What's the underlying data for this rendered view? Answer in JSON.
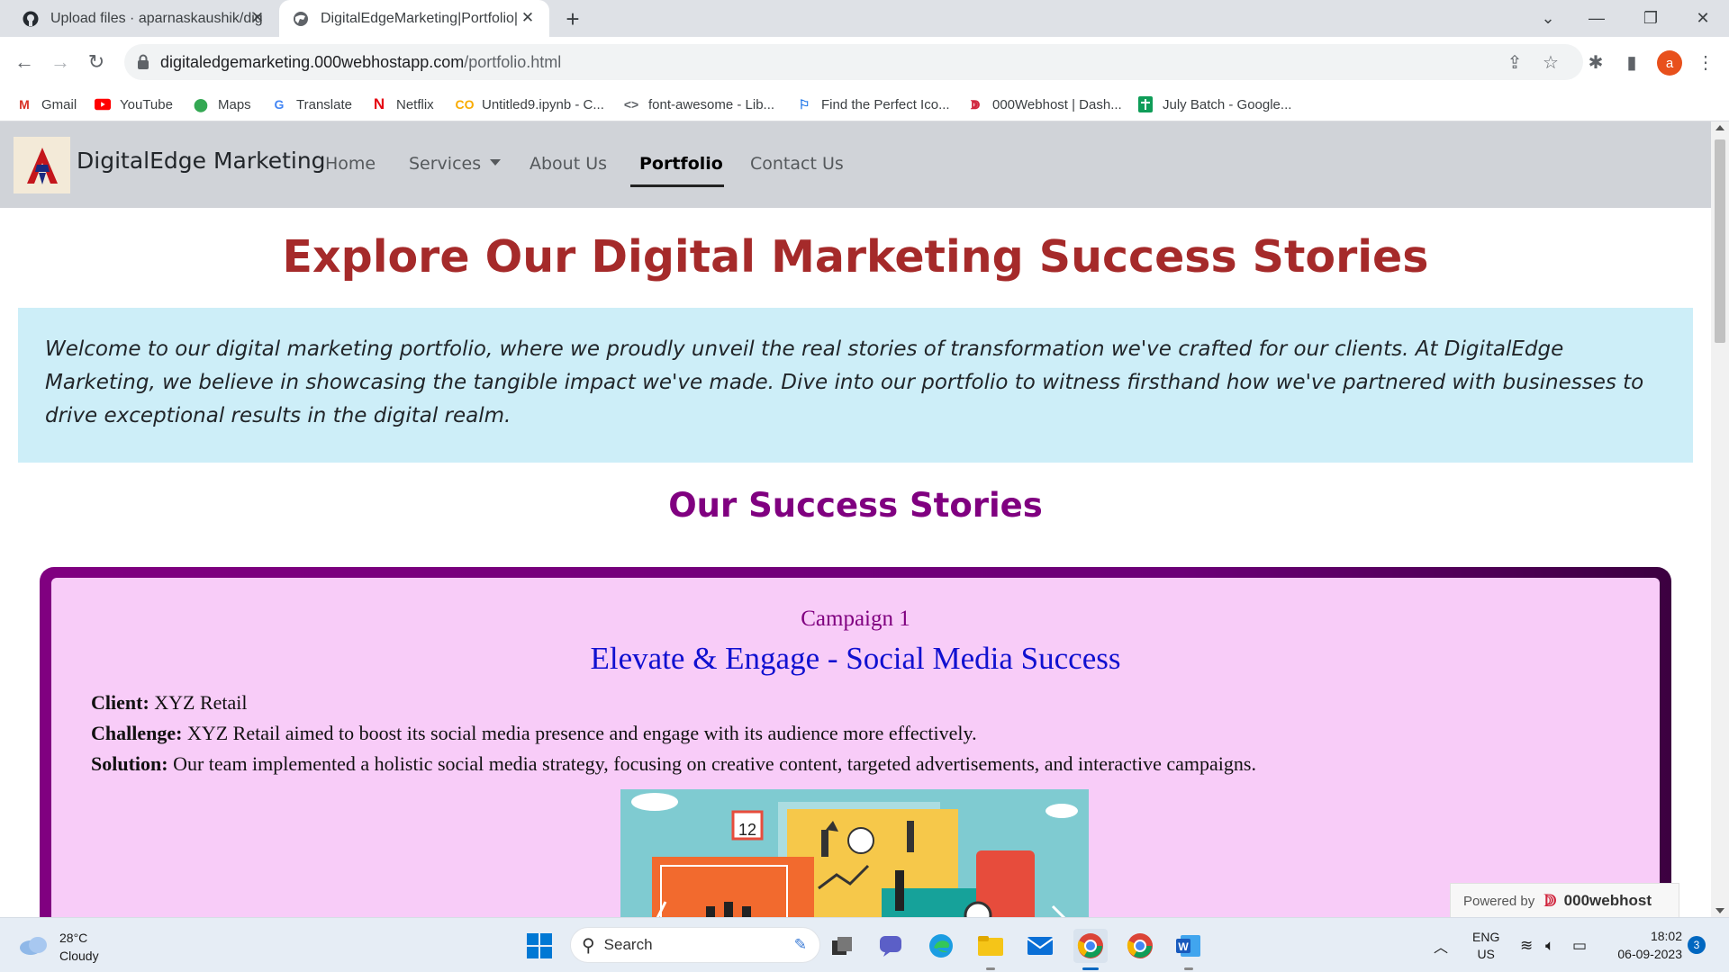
{
  "browser": {
    "tabs": [
      {
        "title": "Upload files · aparnaskaushik/dig",
        "active": false
      },
      {
        "title": "DigitalEdgeMarketing|Portfolio|",
        "active": true
      }
    ],
    "new_tab": "+",
    "url_host": "digitaledgemarketing.000webhostapp.com",
    "url_path": "/portfolio.html",
    "profile_initial": "a",
    "bookmarks": [
      {
        "label": "Gmail",
        "icon": "gmail-icon"
      },
      {
        "label": "YouTube",
        "icon": "youtube-icon"
      },
      {
        "label": "Maps",
        "icon": "maps-icon"
      },
      {
        "label": "Translate",
        "icon": "translate-icon"
      },
      {
        "label": "Netflix",
        "icon": "netflix-icon"
      },
      {
        "label": "Untitled9.ipynb - C...",
        "icon": "colab-icon"
      },
      {
        "label": "font-awesome - Lib...",
        "icon": "code-icon"
      },
      {
        "label": "Find the Perfect Ico...",
        "icon": "flag-icon"
      },
      {
        "label": "000Webhost | Dash...",
        "icon": "webhost-icon"
      },
      {
        "label": "July Batch - Google...",
        "icon": "sheets-icon"
      }
    ]
  },
  "site": {
    "brand": "DigitalEdge Marketing",
    "nav": {
      "home": "Home",
      "services": "Services",
      "about": "About Us",
      "portfolio": "Portfolio",
      "contact": "Contact Us"
    },
    "hero_title": "Explore Our Digital Marketing Success Stories",
    "intro": "Welcome to our digital marketing portfolio, where we proudly unveil the real stories of transformation we've crafted for our clients. At DigitalEdge Marketing, we believe in showcasing the tangible impact we've made. Dive into our portfolio to witness firsthand how we've partnered with businesses to drive exceptional results in the digital realm.",
    "section_title": "Our Success Stories",
    "campaign": {
      "number": "Campaign 1",
      "title": "Elevate & Engage - Social Media Success",
      "client_label": "Client:",
      "client": "XYZ Retail",
      "challenge_label": "Challenge:",
      "challenge": "XYZ Retail aimed to boost its social media presence and engage with its audience more effectively.",
      "solution_label": "Solution:",
      "solution": "Our team implemented a holistic social media strategy, focusing on creative content, targeted advertisements, and interactive campaigns.",
      "image_calendar_number": "12"
    },
    "powered_by": "Powered by",
    "powered_brand": "000webhost"
  },
  "taskbar": {
    "weather_temp": "28°C",
    "weather_desc": "Cloudy",
    "search_label": "Search",
    "lang_top": "ENG",
    "lang_bottom": "US",
    "time": "18:02",
    "date": "06-09-2023",
    "notifications": "3"
  },
  "colors": {
    "hero": "#a52a2a",
    "section": "#800080",
    "intro_bg": "#cdeef8",
    "card_bg": "#f8ccf8",
    "campaign_title": "#1010d0"
  }
}
